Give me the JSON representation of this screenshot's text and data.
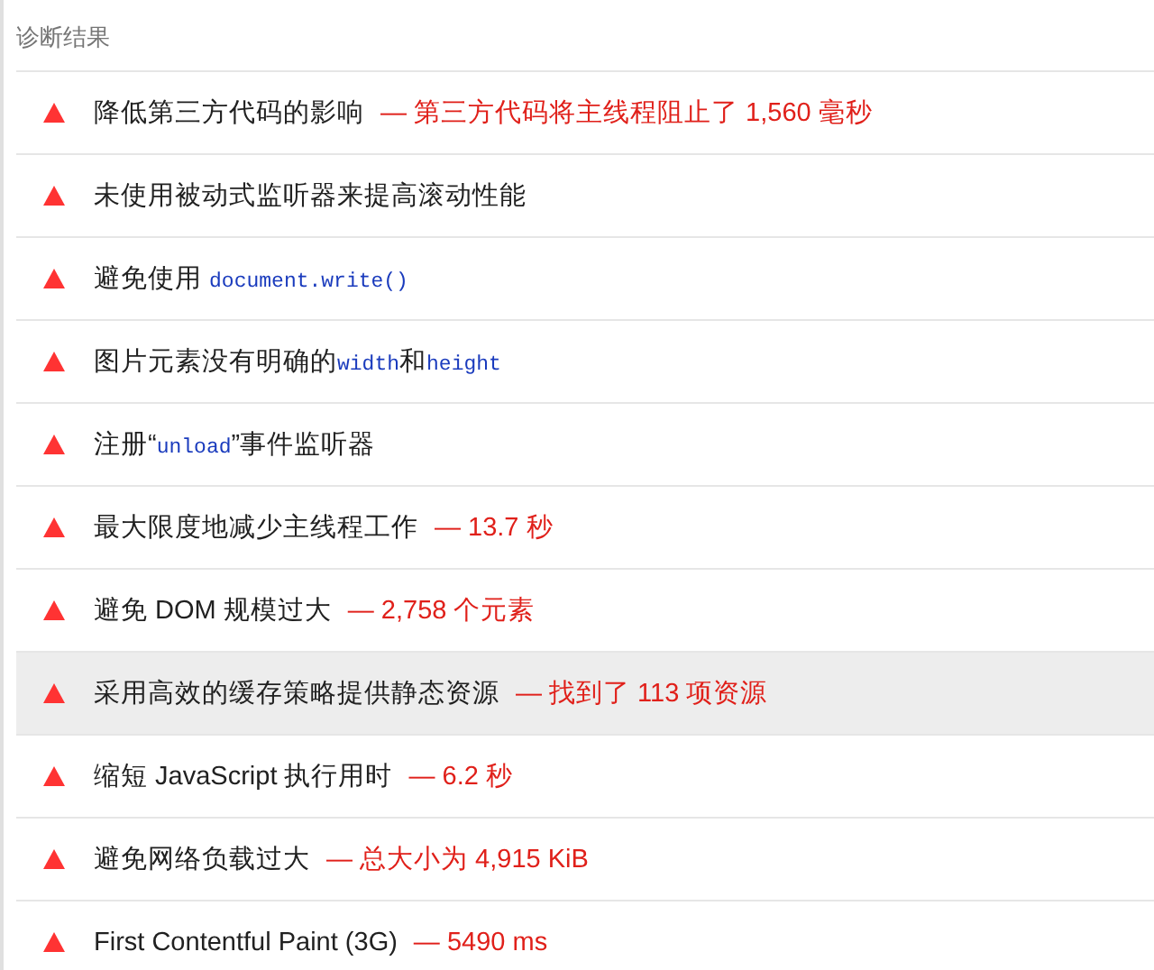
{
  "section": {
    "title": "诊断结果"
  },
  "audits": [
    {
      "highlighted": false,
      "title": [
        {
          "kind": "text",
          "text": "降低第三方代码的影响"
        }
      ],
      "detail": "— 第三方代码将主线程阻止了 1,560 毫秒"
    },
    {
      "highlighted": false,
      "title": [
        {
          "kind": "text",
          "text": "未使用被动式监听器来提高滚动性能"
        }
      ]
    },
    {
      "highlighted": false,
      "title": [
        {
          "kind": "text",
          "text": "避免使用 "
        },
        {
          "kind": "code",
          "text": "document.write()"
        }
      ]
    },
    {
      "highlighted": false,
      "title": [
        {
          "kind": "text",
          "text": "图片元素没有明确的"
        },
        {
          "kind": "code",
          "text": "width"
        },
        {
          "kind": "text",
          "text": "和"
        },
        {
          "kind": "code",
          "text": "height"
        }
      ]
    },
    {
      "highlighted": false,
      "title": [
        {
          "kind": "text",
          "text": "注册“"
        },
        {
          "kind": "code",
          "text": "unload"
        },
        {
          "kind": "text",
          "text": "”事件监听器"
        }
      ]
    },
    {
      "highlighted": false,
      "title": [
        {
          "kind": "text",
          "text": "最大限度地减少主线程工作"
        }
      ],
      "detail": "— 13.7 秒"
    },
    {
      "highlighted": false,
      "title": [
        {
          "kind": "text",
          "text": "避免 DOM 规模过大"
        }
      ],
      "detail": "— 2,758 个元素"
    },
    {
      "highlighted": true,
      "title": [
        {
          "kind": "text",
          "text": "采用高效的缓存策略提供静态资源"
        }
      ],
      "detail": "— 找到了 113 项资源"
    },
    {
      "highlighted": false,
      "title": [
        {
          "kind": "text",
          "text": "缩短 JavaScript 执行用时"
        }
      ],
      "detail": "— 6.2 秒"
    },
    {
      "highlighted": false,
      "title": [
        {
          "kind": "text",
          "text": "避免网络负载过大"
        }
      ],
      "detail": "— 总大小为 4,915 KiB"
    },
    {
      "highlighted": false,
      "title": [
        {
          "kind": "text",
          "text": "First Contentful Paint (3G)"
        }
      ],
      "detail": "— 5490 ms"
    }
  ]
}
